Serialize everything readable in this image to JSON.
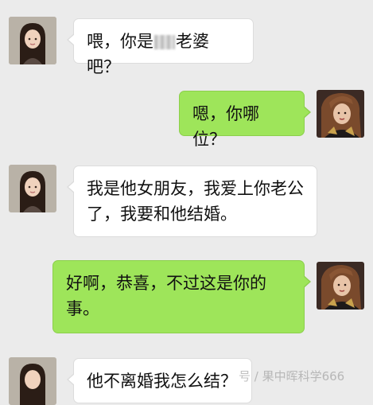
{
  "messages": [
    {
      "side": "in",
      "text_before": "喂，你是",
      "redacted": true,
      "text_after": "老婆吧？"
    },
    {
      "side": "out",
      "text": "嗯，你哪位？"
    },
    {
      "side": "in",
      "text": "我是他女朋友，我爱上你老公了，我要和他结婚。"
    },
    {
      "side": "out",
      "text": "好啊，恭喜，不过这是你的事。"
    },
    {
      "side": "in",
      "text": "他不离婚我怎么结？"
    }
  ],
  "watermark": "号 / 果中晖科学666",
  "colors": {
    "background": "#ebebeb",
    "incoming_bubble": "#ffffff",
    "outgoing_bubble": "#9ee55a"
  },
  "icons": {
    "incoming_avatar": "woman-long-hair-avatar",
    "outgoing_avatar": "woman-portrait-avatar"
  }
}
